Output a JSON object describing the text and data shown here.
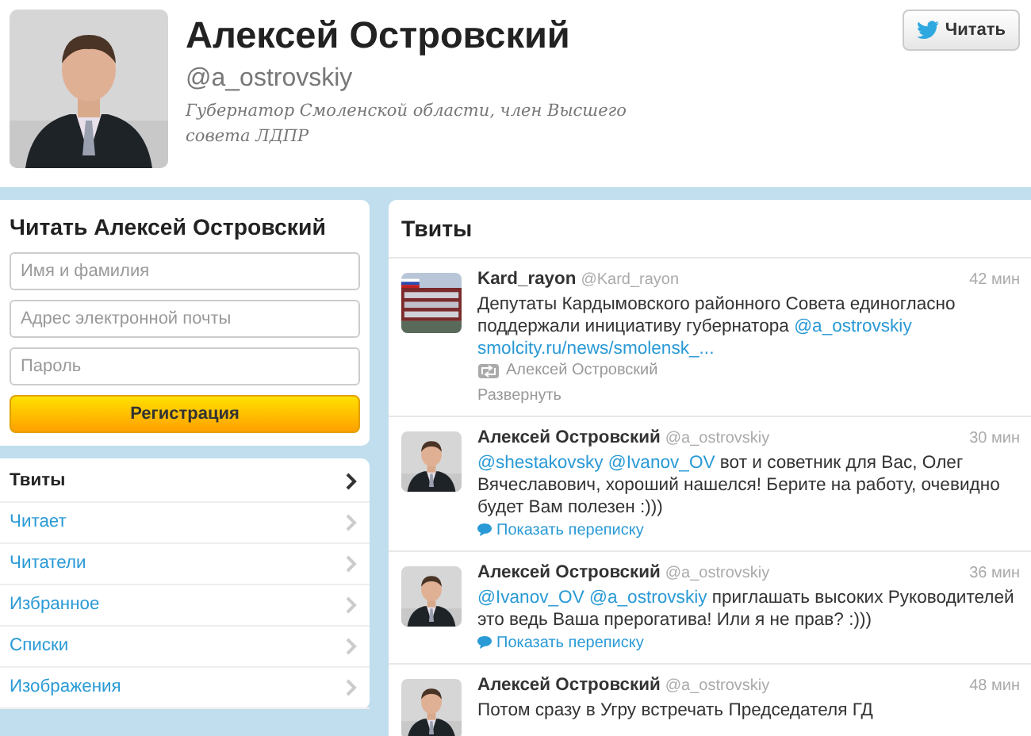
{
  "profile": {
    "name": "Алексей Островский",
    "handle": "@a_ostrovskiy",
    "bio": "Губернатор Смоленской области, член Высшего совета ЛДПР",
    "follow_button": "Читать"
  },
  "signup": {
    "title": "Читать Алексей Островский",
    "fields": [
      {
        "placeholder": "Имя и фамилия"
      },
      {
        "placeholder": "Адрес электронной почты"
      },
      {
        "placeholder": "Пароль"
      }
    ],
    "button": "Регистрация"
  },
  "nav": [
    {
      "label": "Твиты",
      "selected": true
    },
    {
      "label": "Читает",
      "selected": false
    },
    {
      "label": "Читатели",
      "selected": false
    },
    {
      "label": "Избранное",
      "selected": false
    },
    {
      "label": "Списки",
      "selected": false
    },
    {
      "label": "Изображения",
      "selected": false
    }
  ],
  "timeline": {
    "title": "Твиты",
    "tweets": [
      {
        "name": "Kard_rayon",
        "handle": "@Kard_rayon",
        "time": "42 мин",
        "text": [
          {
            "kind": "text",
            "text": "Депутаты Кардымовского районного Совета единогласно поддержали инициативу губернатора "
          },
          {
            "kind": "link",
            "text": "@a_ostrovskiy"
          },
          {
            "kind": "break"
          },
          {
            "kind": "link",
            "text": "smolcity.ru/news/smolensk_..."
          }
        ],
        "retweeted_by": "Алексей Островский",
        "action": {
          "kind": "expand",
          "label": "Развернуть"
        }
      },
      {
        "name": "Алексей Островский",
        "handle": "@a_ostrovskiy",
        "time": "30 мин",
        "text": [
          {
            "kind": "link",
            "text": "@shestakovsky"
          },
          {
            "kind": "link",
            "text": "@Ivanov_OV"
          },
          {
            "kind": "text",
            "text": " вот и советник для Вас, Олег Вячеславович, хороший нашелся! Берите на работу, очевидно будет Вам полезен :)))"
          }
        ],
        "action": {
          "kind": "conversation",
          "label": "Показать переписку"
        }
      },
      {
        "name": "Алексей Островский",
        "handle": "@a_ostrovskiy",
        "time": "36 мин",
        "text": [
          {
            "kind": "link",
            "text": "@Ivanov_OV"
          },
          {
            "kind": "link",
            "text": "@a_ostrovskiy"
          },
          {
            "kind": "text",
            "text": " приглашать высоких Руководителей это ведь Ваша прерогатива! Или я не прав? :)))"
          }
        ],
        "action": {
          "kind": "conversation",
          "label": "Показать переписку"
        }
      },
      {
        "name": "Алексей Островский",
        "handle": "@a_ostrovskiy",
        "time": "48 мин",
        "text": [
          {
            "kind": "text",
            "text": "Потом сразу в Угру встречать Председателя ГД"
          }
        ]
      }
    ]
  }
}
